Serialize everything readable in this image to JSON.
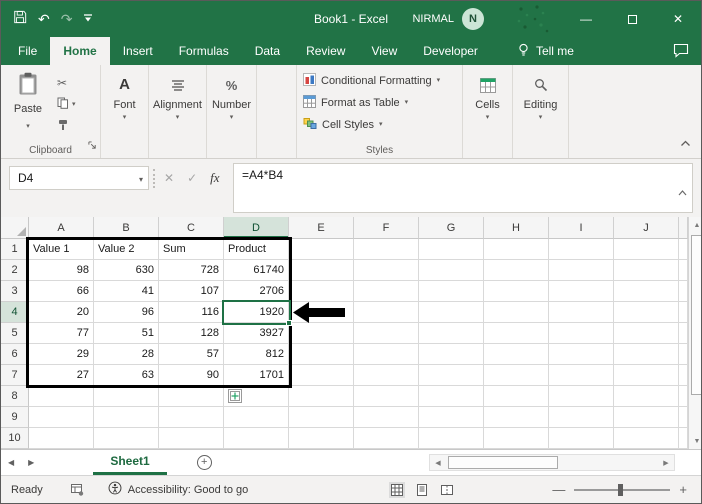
{
  "titlebar": {
    "title": "Book1 - Excel",
    "user_name": "NIRMAL",
    "user_initial": "N"
  },
  "tabs": [
    {
      "label": "File"
    },
    {
      "label": "Home"
    },
    {
      "label": "Insert"
    },
    {
      "label": "Formulas"
    },
    {
      "label": "Data"
    },
    {
      "label": "Review"
    },
    {
      "label": "View"
    },
    {
      "label": "Developer"
    }
  ],
  "tell_me": {
    "label": "Tell me"
  },
  "ribbon": {
    "paste": "Paste",
    "clipboard_group": "Clipboard",
    "font": "Font",
    "alignment": "Alignment",
    "number": "Number",
    "conditional_formatting": "Conditional Formatting",
    "format_as_table": "Format as Table",
    "cell_styles": "Cell Styles",
    "styles_group": "Styles",
    "cells": "Cells",
    "editing": "Editing"
  },
  "formula_bar": {
    "name_box": "D4",
    "fx": "fx",
    "formula": "=A4*B4"
  },
  "sheet": {
    "column_headers": [
      "A",
      "B",
      "C",
      "D",
      "E",
      "F",
      "G",
      "H",
      "I",
      "J"
    ],
    "row_headers": [
      "1",
      "2",
      "3",
      "4",
      "5",
      "6",
      "7",
      "8",
      "9",
      "10"
    ],
    "selected_cell": "D4",
    "selected_column": "D",
    "selected_row": "4",
    "table": {
      "range": "A1:D7",
      "rows": [
        [
          "Value 1",
          "Value 2",
          "Sum",
          "Product"
        ],
        [
          "98",
          "630",
          "728",
          "61740"
        ],
        [
          "66",
          "41",
          "107",
          "2706"
        ],
        [
          "20",
          "96",
          "116",
          "1920"
        ],
        [
          "77",
          "51",
          "128",
          "3927"
        ],
        [
          "29",
          "28",
          "57",
          "812"
        ],
        [
          "27",
          "63",
          "90",
          "1701"
        ]
      ]
    }
  },
  "sheet_bar": {
    "active_sheet": "Sheet1"
  },
  "status_bar": {
    "mode": "Ready",
    "accessibility": "Accessibility: Good to go"
  },
  "icons": {
    "undo": "↶",
    "redo": "↷",
    "caret": "▾",
    "cut": "✂",
    "close": "✕",
    "minimize": "—",
    "cancel": "✕",
    "enter": "✓",
    "up-arrow": "▲",
    "down-arrow": "▼",
    "left-arrow": "◀",
    "right-arrow": "▶",
    "plus": "+",
    "minus": "—",
    "percent": "%"
  },
  "colors": {
    "excel_green": "#217346",
    "selection_green": "#1e7145",
    "ribbon_bg": "#f3f2f1"
  }
}
